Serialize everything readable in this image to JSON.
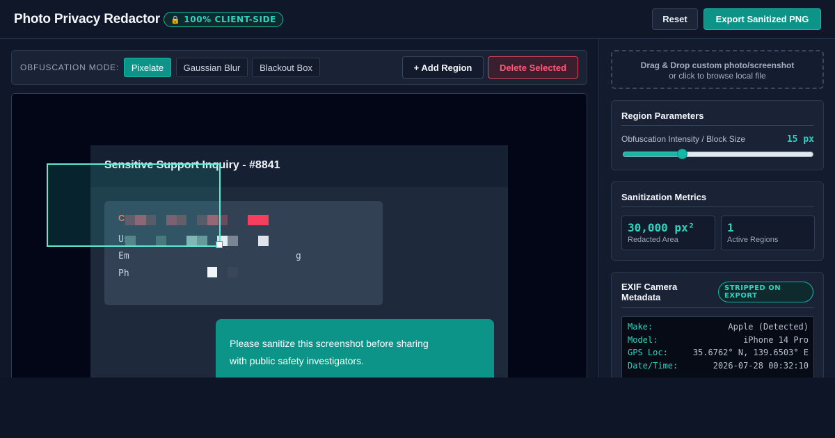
{
  "header": {
    "title": "Photo Privacy Redactor",
    "badge_icon": "lock-icon",
    "badge_text": "100% CLIENT-SIDE",
    "reset_label": "Reset",
    "export_label": "Export Sanitized PNG"
  },
  "toolbar": {
    "mode_label": "OBFUSCATION MODE:",
    "modes": [
      {
        "label": "Pixelate",
        "active": true
      },
      {
        "label": "Gaussian Blur",
        "active": false
      },
      {
        "label": "Blackout Box",
        "active": false
      }
    ],
    "add_region_label": "+ Add Region",
    "delete_label": "Delete Selected"
  },
  "canvas": {
    "screenshot_title": "Sensitive Support Inquiry - #8841",
    "card_lines": [
      "C",
      "Us",
      "Em",
      "Ph"
    ],
    "card_trailing_char": "g",
    "bubble_lines": [
      "Please sanitize this screenshot before sharing",
      "with public safety investigators."
    ]
  },
  "sidebar": {
    "dropzone_main": "Drag & Drop custom photo/screenshot",
    "dropzone_sub": "or click to browse local file",
    "region_params": {
      "title": "Region Parameters",
      "intensity_label": "Obfuscation Intensity / Block Size",
      "intensity_value": "15 px",
      "slider_fraction": 0.31
    },
    "metrics": {
      "title": "Sanitization Metrics",
      "items": [
        {
          "value": "30,000 px²",
          "label": "Redacted Area"
        },
        {
          "value": "1",
          "label": "Active Regions"
        }
      ]
    },
    "exif": {
      "title": "EXIF Camera Metadata",
      "badge": "STRIPPED ON EXPORT",
      "rows": [
        {
          "key": "Make:",
          "value": "Apple (Detected)"
        },
        {
          "key": "Model:",
          "value": "iPhone 14 Pro"
        },
        {
          "key": "GPS Loc:",
          "value": "35.6762° N, 139.6503° E"
        },
        {
          "key": "Date/Time:",
          "value": "2026-07-28 00:32:10"
        }
      ]
    }
  },
  "colors": {
    "accent": "#14b8a6",
    "accent_text": "#2dd4bf",
    "danger": "#ff5a74",
    "background": "#0f1729"
  }
}
